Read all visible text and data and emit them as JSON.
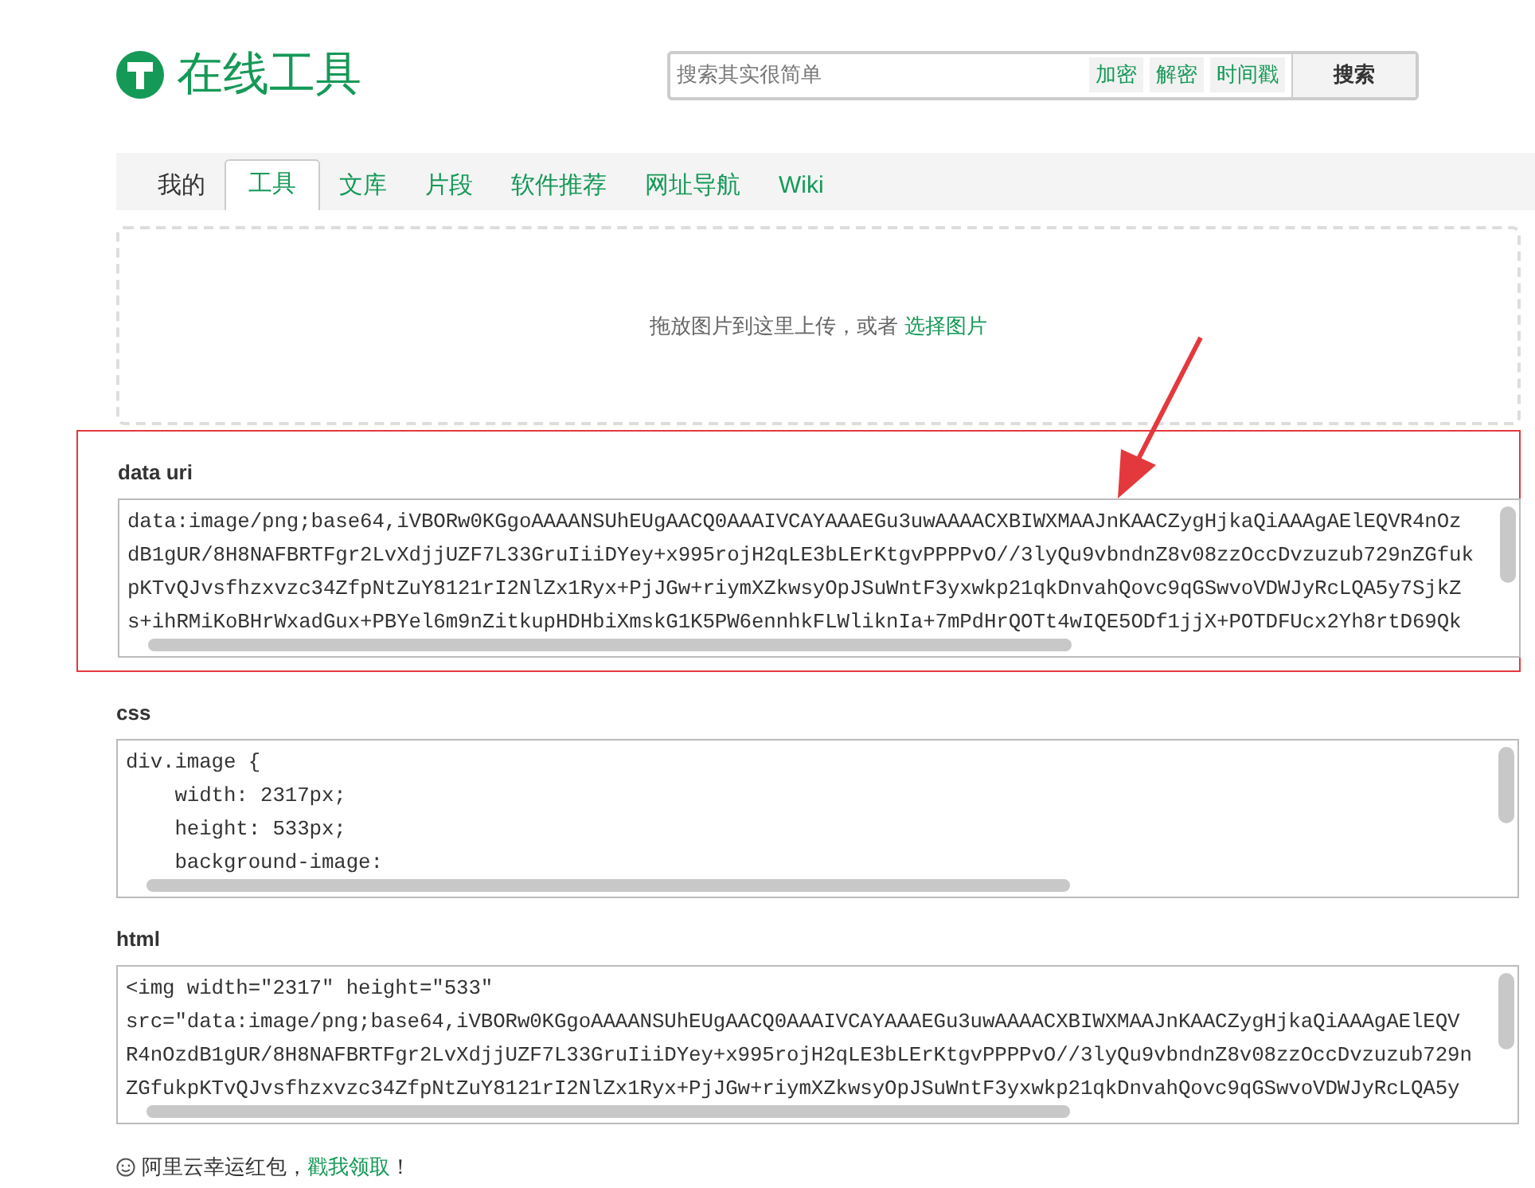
{
  "header": {
    "logo_text": "在线工具",
    "search": {
      "placeholder": "搜索其实很简单",
      "quick_links": [
        "加密",
        "解密",
        "时间戳"
      ],
      "button": "搜索"
    }
  },
  "tabs": [
    {
      "label": "我的",
      "selected": false
    },
    {
      "label": "工具",
      "selected": true
    },
    {
      "label": "文库",
      "selected": false
    },
    {
      "label": "片段",
      "selected": false
    },
    {
      "label": "软件推荐",
      "selected": false
    },
    {
      "label": "网址导航",
      "selected": false
    },
    {
      "label": "Wiki",
      "selected": false
    }
  ],
  "upload": {
    "text": "拖放图片到这里上传，或者",
    "link": "选择图片"
  },
  "sections": [
    {
      "label": "data uri",
      "highlighted": true,
      "lines": [
        "data:image/png;base64,iVBORw0KGgoAAAANSUhEUgAACQ0AAAIVCAYAAAEGu3uwAAAACXBIWXMAAJnKAACZygHjkaQiAAAgAElEQVR4nOz",
        "dB1gUR/8H8NAFBRTFgr2LvXdjjUZF7L33GruIiiDYey+x995rojH2qLE3bLErKtgvPPPPvO//3lyQu9vbndnZ8v08zzOccDvzuzub729nZGfuk",
        "pKTvQJvsfhzxvzc34ZfpNtZuY8121rI2NlZx1Ryx+PjJGw+riymXZkwsyOpJSuWntF3yxwkp21qkDnvahQovc9qGSwvoVDWJyRcLQA5y7SjkZ",
        "s+ihRMiKoBHrWxadGux+PBYel6m9nZitkupHDHbiXmskG1K5PW6ennhkFLWliknIa+7mPdHrQOTt4wIQE5ODf1jjX+POTDFUcx2Yh8rtD69Qk"
      ]
    },
    {
      "label": "css",
      "highlighted": false,
      "lines": [
        "div.image {",
        "    width: 2317px;",
        "    height: 533px;",
        "    background-image:"
      ]
    },
    {
      "label": "html",
      "highlighted": false,
      "lines": [
        "<img width=\"2317\" height=\"533\"",
        "src=\"data:image/png;base64,iVBORw0KGgoAAAANSUhEUgAACQ0AAAIVCAYAAAEGu3uwAAAACXBIWXMAAJnKAACZygHjkaQiAAAgAElEQV",
        "R4nOzdB1gUR/8H8NAFBRTFgr2LvXdjjUZF7L33GruIiiDYey+x995rojH2qLE3bLErKtgvPPPPvO//3lyQu9vbndnZ8v08zzOccDvzuzub729n",
        "ZGfukpKTvQJvsfhzxvzc34ZfpNtZuY8121rI2NlZx1Ryx+PjJGw+riymXZkwsyOpJSuWntF3yxwkp21qkDnvahQovc9qGSwvoVDWJyRcLQA5y"
      ]
    }
  ],
  "footer": {
    "text": "阿里云幸运红包，",
    "link": "戳我领取",
    "tail": "！"
  }
}
